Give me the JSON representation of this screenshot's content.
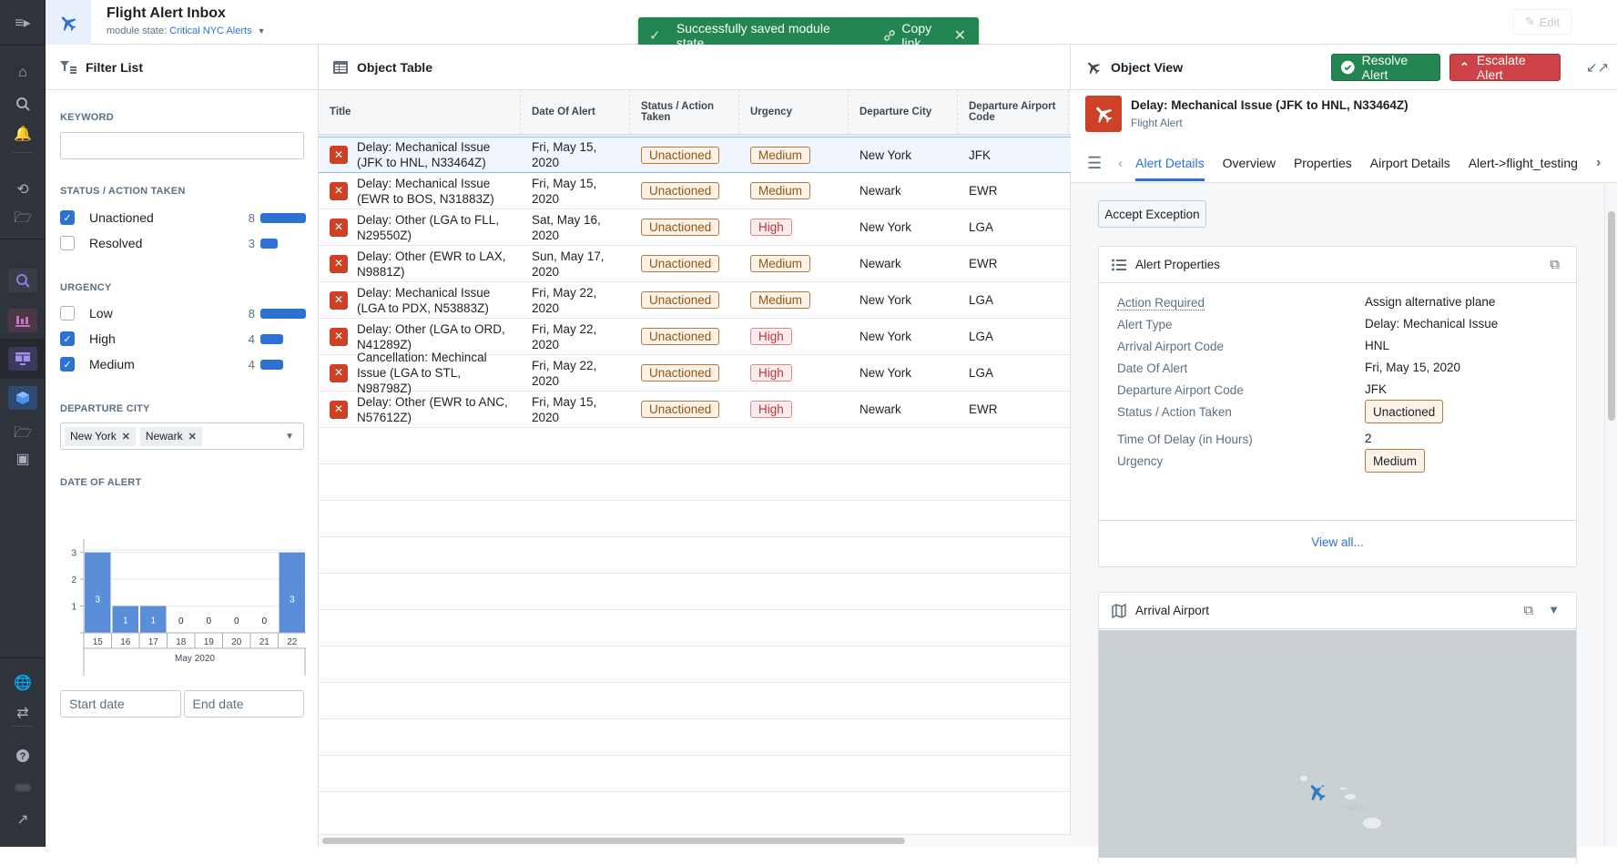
{
  "app": {
    "title": "Flight Alert Inbox",
    "module_state_label": "module state:",
    "module_state_value": "Critical NYC Alerts",
    "edit_label": "Edit"
  },
  "toast": {
    "message": "Successfully saved module state.",
    "copy_link": "Copy link"
  },
  "nav": {
    "items": [
      "menu",
      "home",
      "search",
      "notifications",
      "history",
      "files",
      "object-explorer",
      "quiver",
      "workshop",
      "ontology",
      "favorite-folders",
      "favorite-objects",
      "globe",
      "shuffle",
      "help",
      "account",
      "collapse"
    ]
  },
  "filter": {
    "title": "Filter List",
    "keyword_label": "KEYWORD",
    "keyword_value": "",
    "status_label": "STATUS / ACTION TAKEN",
    "status_options": [
      {
        "label": "Unactioned",
        "count": "8",
        "checked": true,
        "fraction": 1.0
      },
      {
        "label": "Resolved",
        "count": "3",
        "checked": false,
        "fraction": 0.375
      }
    ],
    "urgency_label": "URGENCY",
    "urgency_options": [
      {
        "label": "Low",
        "count": "8",
        "checked": false,
        "fraction": 1.0
      },
      {
        "label": "High",
        "count": "4",
        "checked": true,
        "fraction": 0.5
      },
      {
        "label": "Medium",
        "count": "4",
        "checked": true,
        "fraction": 0.5
      }
    ],
    "city_label": "DEPARTURE CITY",
    "city_tags": [
      "New York",
      "Newark"
    ],
    "date_label": "DATE OF ALERT",
    "start_placeholder": "Start date",
    "end_placeholder": "End date"
  },
  "chart_data": {
    "type": "bar",
    "title": "DATE OF ALERT",
    "categories": [
      "15",
      "16",
      "17",
      "18",
      "19",
      "20",
      "21",
      "22"
    ],
    "values": [
      3,
      1,
      1,
      0,
      0,
      0,
      0,
      3
    ],
    "xlabel": "May 2020",
    "ylabel": "",
    "yticks": [
      1,
      2,
      3
    ],
    "ylim": [
      0,
      3.5
    ],
    "grid": true,
    "bar_color": "#5b8ed9"
  },
  "table": {
    "title": "Object Table",
    "columns": [
      "Title",
      "Date Of Alert",
      "Status / Action Taken",
      "Urgency",
      "Departure City",
      "Departure Airport Code"
    ],
    "rows": [
      {
        "title": "Delay: Mechanical Issue (JFK to HNL, N33464Z)",
        "date": "Fri, May 15, 2020",
        "status": "Unactioned",
        "urgency": "Medium",
        "city": "New York",
        "code": "JFK",
        "selected": true
      },
      {
        "title": "Delay: Mechanical Issue (EWR to BOS, N31883Z)",
        "date": "Fri, May 15, 2020",
        "status": "Unactioned",
        "urgency": "Medium",
        "city": "Newark",
        "code": "EWR"
      },
      {
        "title": "Delay: Other (LGA to FLL, N29550Z)",
        "date": "Sat, May 16, 2020",
        "status": "Unactioned",
        "urgency": "High",
        "city": "New York",
        "code": "LGA"
      },
      {
        "title": "Delay: Other (EWR to LAX, N9881Z)",
        "date": "Sun, May 17, 2020",
        "status": "Unactioned",
        "urgency": "Medium",
        "city": "Newark",
        "code": "EWR"
      },
      {
        "title": "Delay: Mechanical Issue (LGA to PDX, N53883Z)",
        "date": "Fri, May 22, 2020",
        "status": "Unactioned",
        "urgency": "Medium",
        "city": "New York",
        "code": "LGA"
      },
      {
        "title": "Delay: Other (LGA to ORD, N41289Z)",
        "date": "Fri, May 22, 2020",
        "status": "Unactioned",
        "urgency": "High",
        "city": "New York",
        "code": "LGA"
      },
      {
        "title": "Cancellation: Mechincal Issue (LGA to STL, N98798Z)",
        "date": "Fri, May 22, 2020",
        "status": "Unactioned",
        "urgency": "High",
        "city": "New York",
        "code": "LGA"
      },
      {
        "title": "Delay: Other (EWR to ANC, N57612Z)",
        "date": "Fri, May 15, 2020",
        "status": "Unactioned",
        "urgency": "High",
        "city": "Newark",
        "code": "EWR"
      }
    ]
  },
  "object_view": {
    "title": "Object View",
    "resolve_label": "Resolve Alert",
    "escalate_label": "Escalate Alert",
    "object_title": "Delay: Mechanical Issue (JFK to HNL, N33464Z)",
    "object_type": "Flight Alert",
    "tabs": [
      "Alert Details",
      "Overview",
      "Properties",
      "Airport Details",
      "Alert->flight_testing"
    ],
    "active_tab": "Alert Details",
    "accept_label": "Accept Exception",
    "properties_title": "Alert Properties",
    "properties": [
      {
        "label": "Action Required",
        "value": "Assign alternative plane"
      },
      {
        "label": "Alert Type",
        "value": "Delay: Mechanical Issue"
      },
      {
        "label": "Arrival Airport Code",
        "value": "HNL"
      },
      {
        "label": "Date Of Alert",
        "value": "Fri, May 15, 2020"
      },
      {
        "label": "Departure Airport Code",
        "value": "JFK"
      },
      {
        "label": "Status / Action Taken",
        "value": "Unactioned",
        "pill": true
      },
      {
        "label": "Time Of Delay (in Hours)",
        "value": "2"
      },
      {
        "label": "Urgency",
        "value": "Medium",
        "pill": true
      }
    ],
    "view_all": "View all...",
    "map_title": "Arrival Airport",
    "map_label": "HAWAII"
  },
  "colors": {
    "accent": "#2d72d2",
    "success": "#238551",
    "danger": "#cd4246",
    "alert_icon": "#cd4226"
  }
}
